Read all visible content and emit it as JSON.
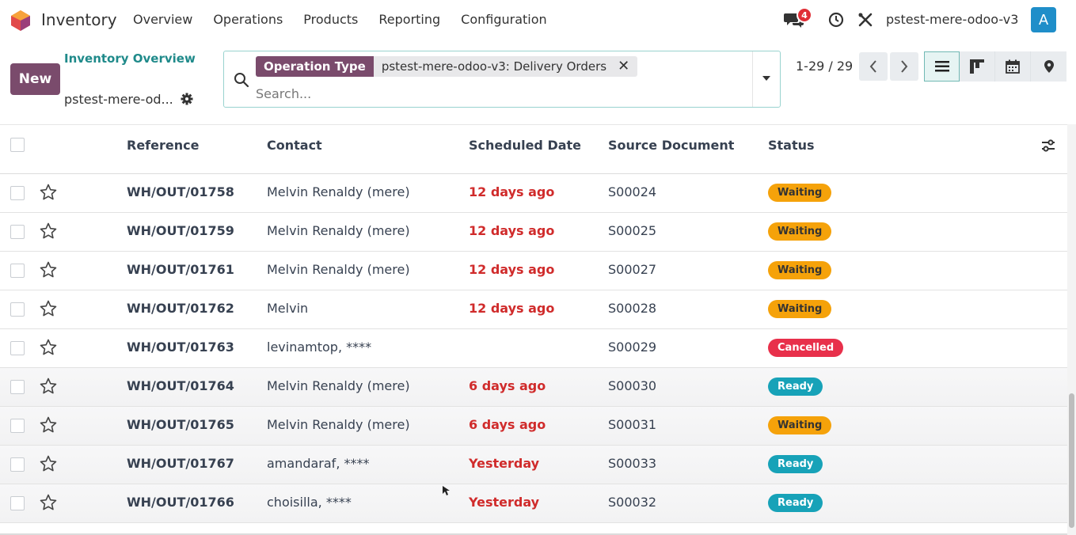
{
  "navbar": {
    "app_title": "Inventory",
    "menu": [
      "Overview",
      "Operations",
      "Products",
      "Reporting",
      "Configuration"
    ],
    "chat_count": "4",
    "db_name": "pstest-mere-odoo-v3",
    "avatar_letter": "A"
  },
  "control": {
    "new_label": "New",
    "breadcrumb": "Inventory Overview",
    "subtitle": "pstest-mere-od...",
    "facet_key": "Operation Type",
    "facet_value": "pstest-mere-odoo-v3: Delivery Orders",
    "search_placeholder": "Search...",
    "pager": "1-29 / 29"
  },
  "table": {
    "headers": {
      "reference": "Reference",
      "contact": "Contact",
      "scheduled_date": "Scheduled Date",
      "source_document": "Source Document",
      "status": "Status"
    },
    "rows": [
      {
        "reference": "WH/OUT/01758",
        "contact": "Melvin Renaldy (mere)",
        "scheduled": "12 days ago",
        "source": "S00024",
        "status": "Waiting"
      },
      {
        "reference": "WH/OUT/01759",
        "contact": "Melvin Renaldy (mere)",
        "scheduled": "12 days ago",
        "source": "S00025",
        "status": "Waiting"
      },
      {
        "reference": "WH/OUT/01761",
        "contact": "Melvin Renaldy (mere)",
        "scheduled": "12 days ago",
        "source": "S00027",
        "status": "Waiting"
      },
      {
        "reference": "WH/OUT/01762",
        "contact": "Melvin",
        "scheduled": "12 days ago",
        "source": "S00028",
        "status": "Waiting"
      },
      {
        "reference": "WH/OUT/01763",
        "contact": "levinamtop, ****",
        "scheduled": "",
        "source": "S00029",
        "status": "Cancelled"
      },
      {
        "reference": "WH/OUT/01764",
        "contact": "Melvin Renaldy (mere)",
        "scheduled": "6 days ago",
        "source": "S00030",
        "status": "Ready"
      },
      {
        "reference": "WH/OUT/01765",
        "contact": "Melvin Renaldy (mere)",
        "scheduled": "6 days ago",
        "source": "S00031",
        "status": "Waiting"
      },
      {
        "reference": "WH/OUT/01767",
        "contact": "amandaraf, ****",
        "scheduled": "Yesterday",
        "source": "S00033",
        "status": "Ready"
      },
      {
        "reference": "WH/OUT/01766",
        "contact": "choisilla, ****",
        "scheduled": "Yesterday",
        "source": "S00032",
        "status": "Ready"
      }
    ]
  },
  "colors": {
    "brand": "#7a4b6c",
    "accent": "#1f8a8a",
    "late": "#d02b2b",
    "waiting": "#f5a20a",
    "cancelled": "#e8304b",
    "ready": "#17a2b8"
  }
}
